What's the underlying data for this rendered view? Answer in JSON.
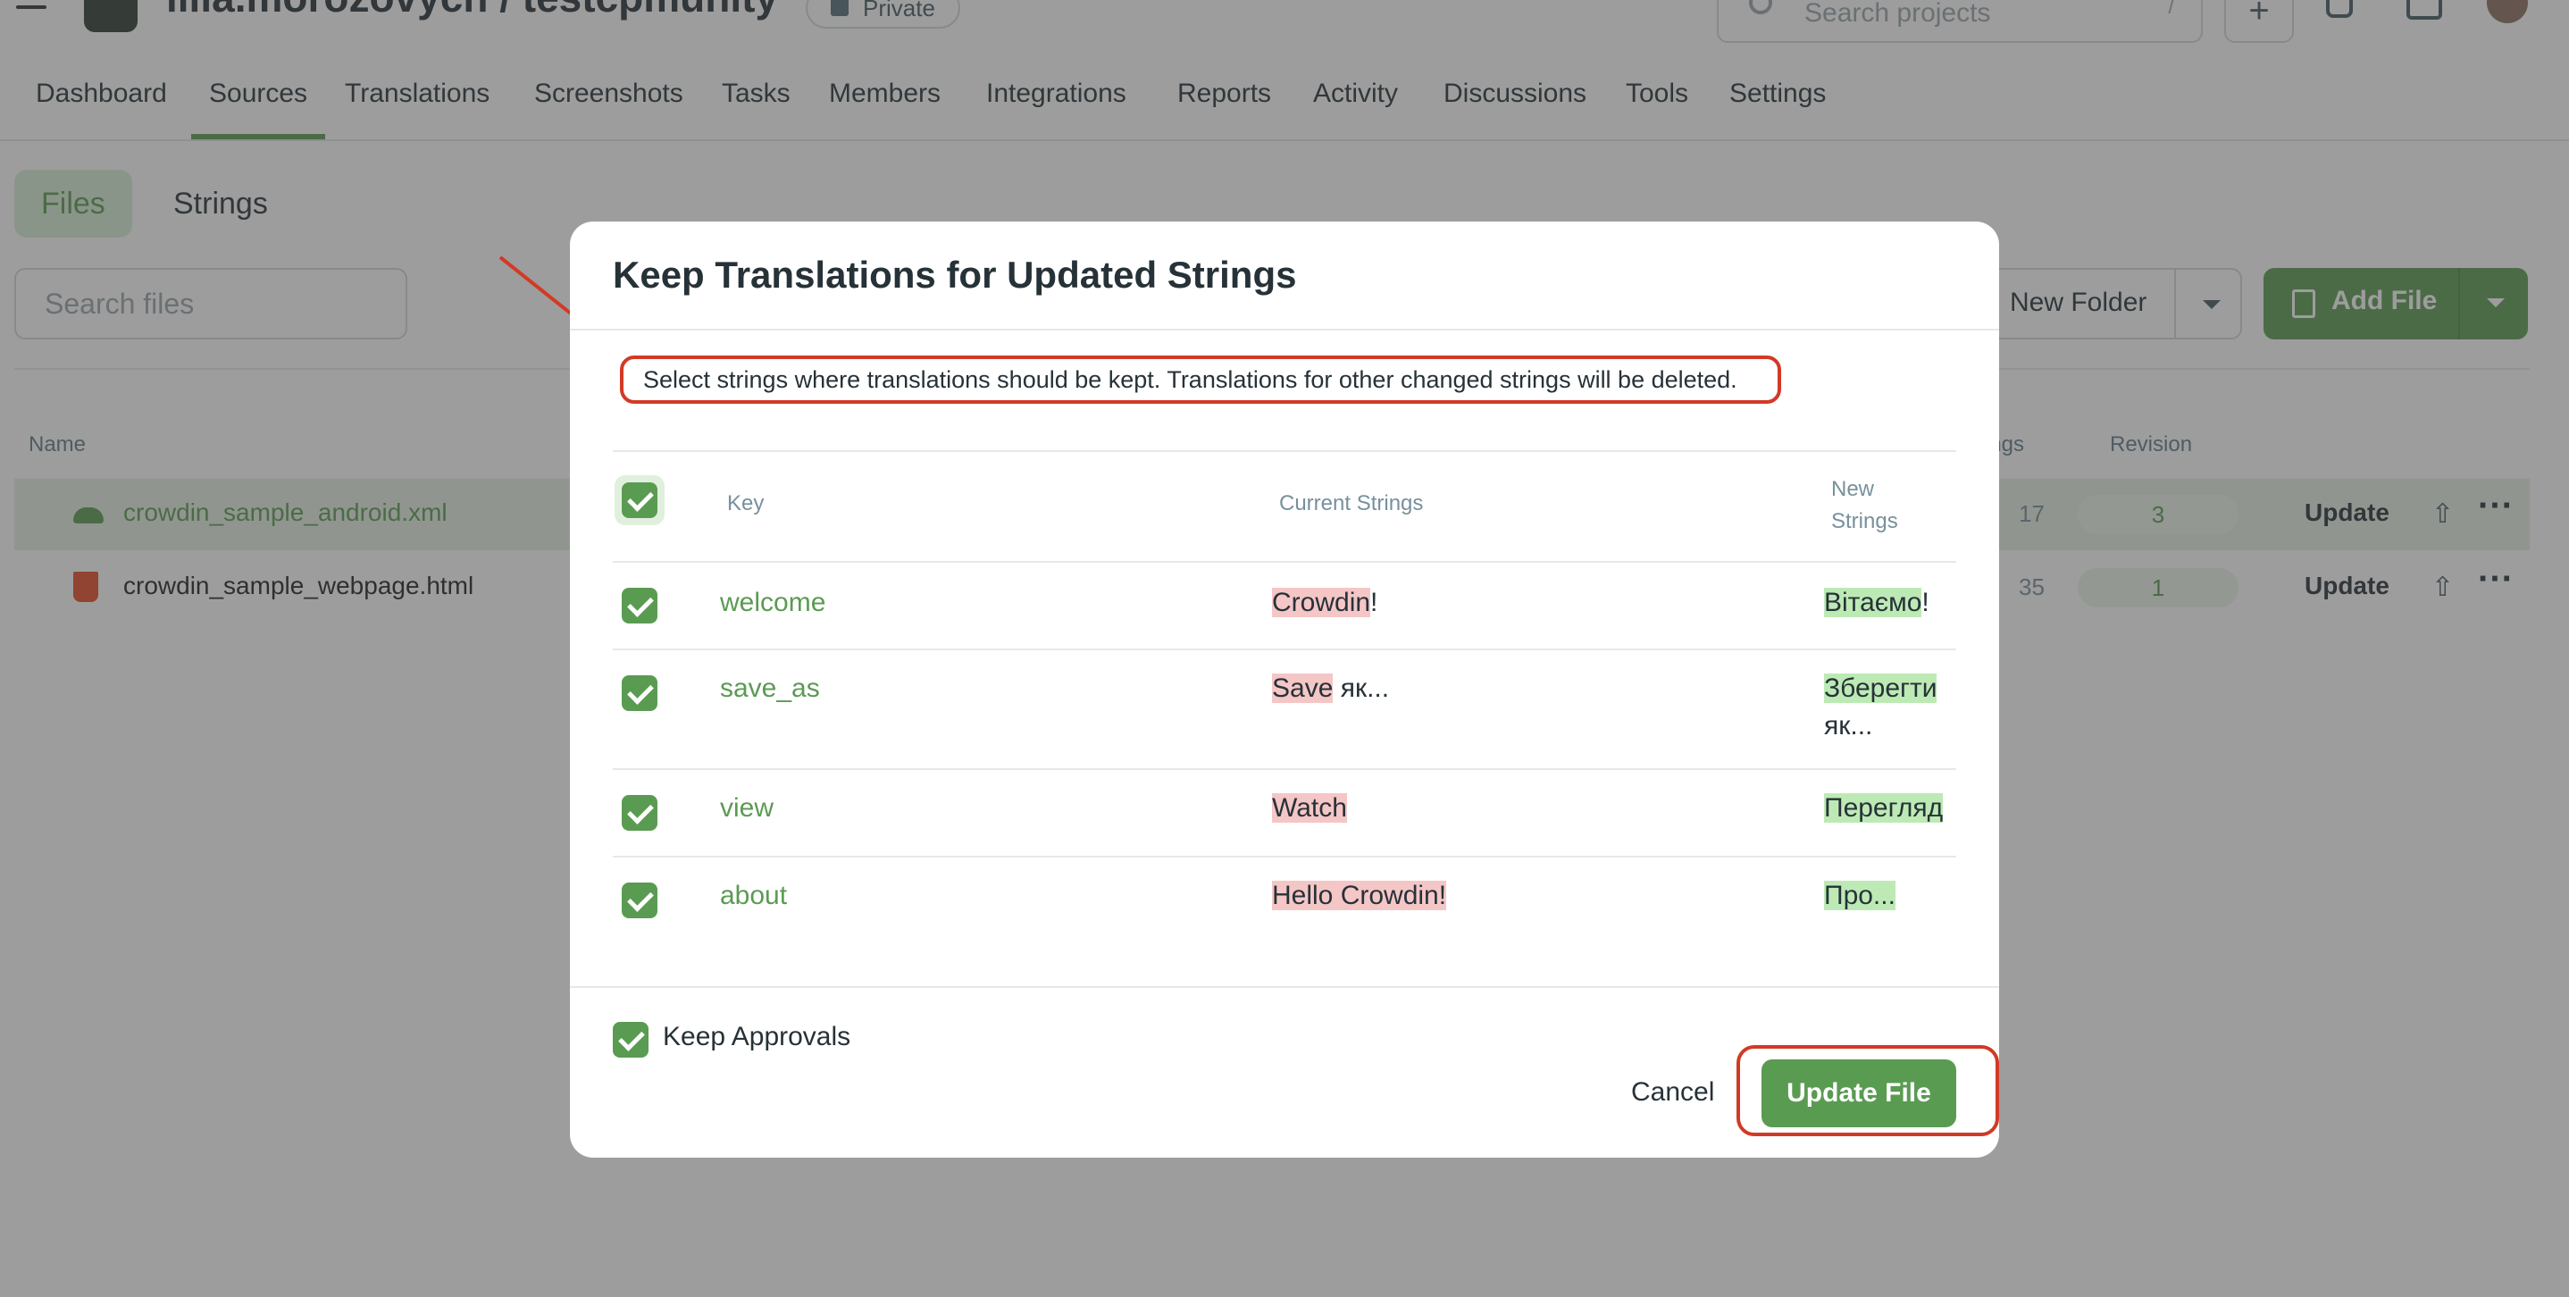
{
  "header": {
    "project_title": "lilia.morozovych / testcpmunity",
    "private_label": "Private",
    "search_placeholder": "Search projects",
    "search_shortcut": "/",
    "plus_label": "+"
  },
  "main_tabs": [
    "Dashboard",
    "Sources",
    "Translations",
    "Screenshots",
    "Tasks",
    "Members",
    "Integrations",
    "Reports",
    "Activity",
    "Discussions",
    "Tools",
    "Settings"
  ],
  "sub_tabs": {
    "files": "Files",
    "strings": "Strings"
  },
  "toolbar": {
    "search_placeholder": "Search files",
    "new_folder": "New Folder",
    "add_file": "Add File"
  },
  "files_table": {
    "col_name": "Name",
    "col_strings": "rings",
    "col_revision": "Revision",
    "rows": [
      {
        "name": "crowdin_sample_android.xml",
        "strings": "17",
        "revision": "3",
        "action": "Update"
      },
      {
        "name": "crowdin_sample_webpage.html",
        "strings": "35",
        "revision": "1",
        "action": "Update"
      }
    ]
  },
  "modal": {
    "title": "Keep Translations for Updated Strings",
    "description": "Select strings where translations should be kept. Translations for other changed strings will be deleted.",
    "col_key": "Key",
    "col_current": "Current Strings",
    "col_new_1": "New",
    "col_new_2": "Strings",
    "rows": [
      {
        "key": "welcome",
        "cur_hl": "Crowdin",
        "cur_rest": "!",
        "new_hl": "Вітаємо",
        "new_rest": "!"
      },
      {
        "key": "save_as",
        "cur_hl": "Save",
        "cur_rest": " як...",
        "new_hl": "Зберегти",
        "new_rest": "як..."
      },
      {
        "key": "view",
        "cur_hl": "Watch",
        "cur_rest": "",
        "new_hl": "Перегляд",
        "new_rest": ""
      },
      {
        "key": "about",
        "cur_hl": "Hello Crowdin!",
        "cur_rest": "",
        "new_hl": "Про...",
        "new_rest": ""
      }
    ],
    "keep_approvals": "Keep Approvals",
    "cancel": "Cancel",
    "update_file": "Update File"
  },
  "colors": {
    "accent": "#5a9b52",
    "annotation": "#d23a26"
  }
}
